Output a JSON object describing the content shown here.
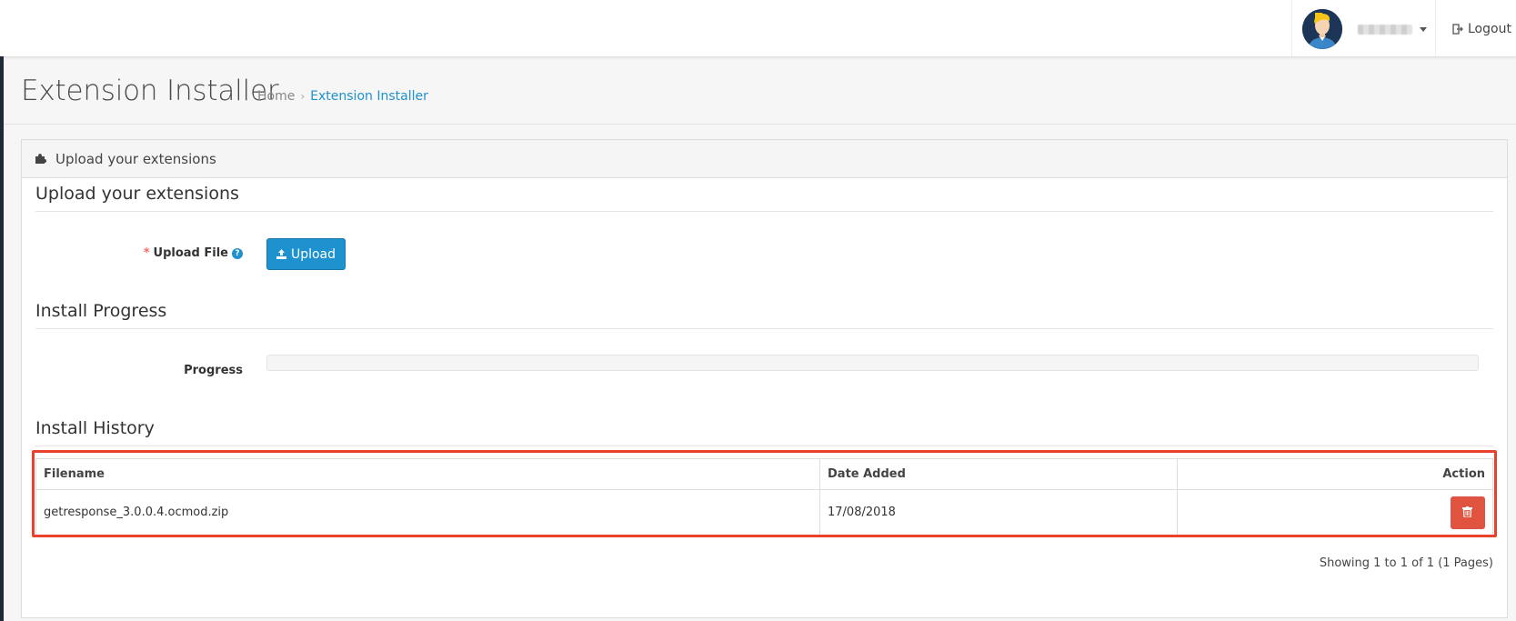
{
  "header": {
    "logout_label": "Logout"
  },
  "page": {
    "title": "Extension Installer",
    "breadcrumb": [
      {
        "label": "Home"
      },
      {
        "label": "Extension Installer"
      }
    ]
  },
  "panel": {
    "heading": "Upload your extensions",
    "upload_section": {
      "legend": "Upload your extensions",
      "field_label": "Upload File",
      "help_icon": "?",
      "button_label": "Upload"
    },
    "progress_section": {
      "legend": "Install Progress",
      "field_label": "Progress",
      "progress_fraction": 0
    },
    "history_section": {
      "legend": "Install History",
      "columns": [
        "Filename",
        "Date Added",
        "Action"
      ],
      "rows": [
        {
          "filename": "getresponse_3.0.0.4.ocmod.zip",
          "date_added": "17/08/2018"
        }
      ],
      "results_text": "Showing 1 to 1 of 1 (1 Pages)"
    }
  },
  "colors": {
    "primary": "#1e91cf",
    "danger": "#e0533f",
    "highlight": "#e8412c"
  },
  "icons": {
    "heading": "puzzle-piece-icon",
    "upload": "upload-icon",
    "delete": "trash-icon",
    "logout": "sign-out-icon"
  }
}
